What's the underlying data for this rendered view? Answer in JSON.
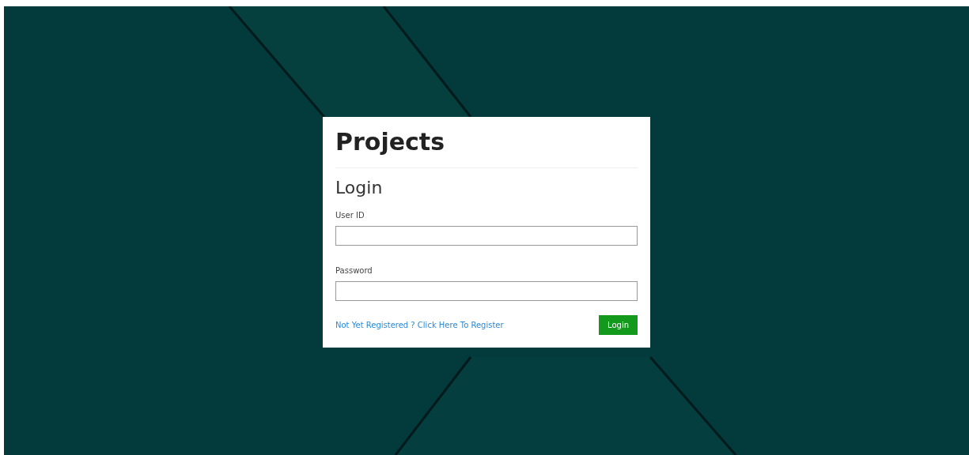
{
  "app_title": "Projects",
  "form": {
    "heading": "Login",
    "fields": [
      {
        "label": "User ID"
      },
      {
        "label": "Password"
      }
    ],
    "register_link": "Not Yet Registered ? Click Here To Register",
    "submit_button": "Login"
  }
}
